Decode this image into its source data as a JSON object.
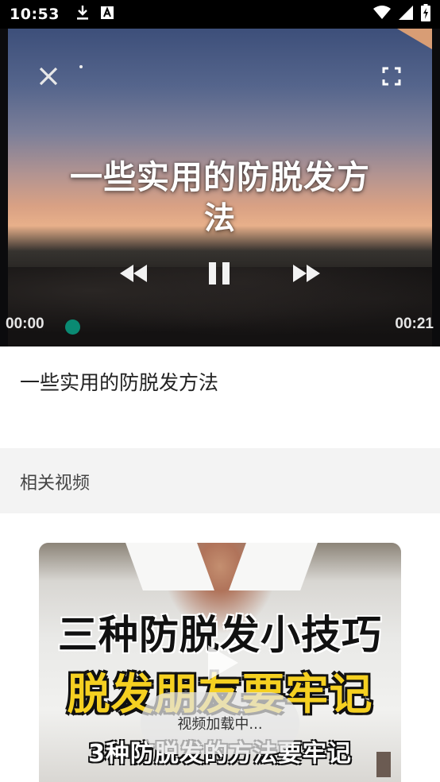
{
  "status_bar": {
    "time": "10:53",
    "left_icons": [
      "download-icon",
      "text-a-icon"
    ],
    "right_icons": [
      "wifi-icon",
      "signal-icon",
      "battery-charging-icon"
    ]
  },
  "player": {
    "caption_line1": "一些实用的防脱发方",
    "caption_line2": "法",
    "current_time": "00:00",
    "total_time": "00:21",
    "progress": 0.0,
    "accent_color": "#0a8a73",
    "controls": [
      "close-icon",
      "fullscreen-icon",
      "rewind-icon",
      "pause-icon",
      "fast-forward-icon"
    ]
  },
  "video": {
    "title": "一些实用的防脱发方法"
  },
  "related": {
    "section_title": "相关视频",
    "items": [
      {
        "thumb_line1": "三种防脱发小技巧",
        "thumb_line2": "脱发朋友要牢记",
        "thumb_line3": "3种防脱发的方法要牢记"
      }
    ]
  },
  "toast": {
    "loading_text": "视频加载中..."
  }
}
